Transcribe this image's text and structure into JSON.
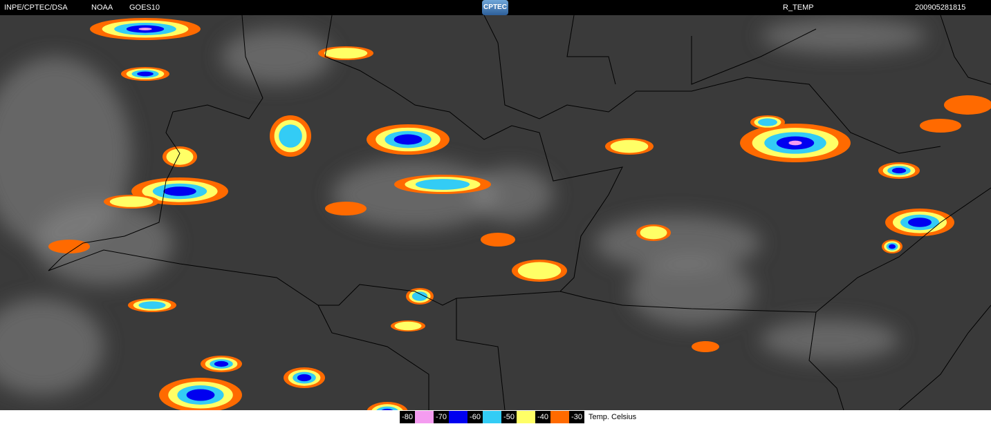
{
  "header": {
    "source": "INPE/CPTEC/DSA",
    "agency": "NOAA",
    "satellite": "GOES10",
    "logo_text": "CPTEC",
    "product": "R_TEMP",
    "timestamp": "200905281815"
  },
  "legend": {
    "title": "Temp. Celsius",
    "entries": [
      {
        "label": "-80",
        "color": "#f49cf0"
      },
      {
        "label": "-70",
        "color": "#0000f0"
      },
      {
        "label": "-60",
        "color": "#33ccf5"
      },
      {
        "label": "-50",
        "color": "#ffff66"
      },
      {
        "label": "-40",
        "color": "#ff6a00"
      },
      {
        "label": "-30",
        "color": null
      }
    ]
  },
  "colors": {
    "background": "#3a3a3a",
    "border": "#000000"
  }
}
